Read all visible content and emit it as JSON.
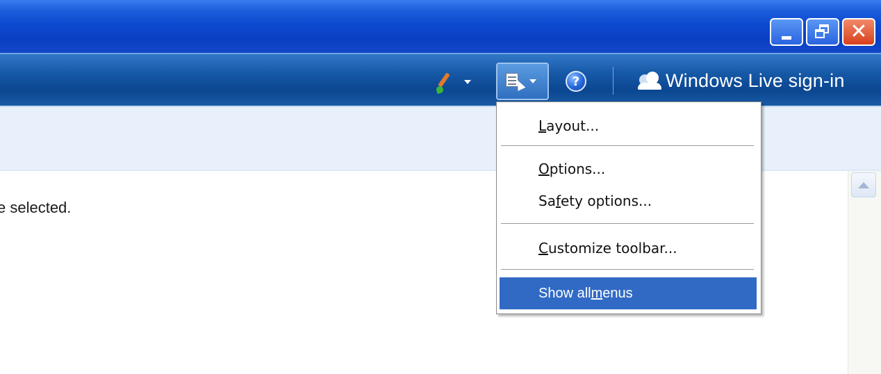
{
  "window": {
    "controls": {
      "minimize_icon": "minimize-icon",
      "restore_icon": "restore-icon",
      "close_icon": "close-icon",
      "close_glyph": "✕"
    }
  },
  "toolbar": {
    "brush_icon": "paintbrush-icon",
    "tools_icon": "tools-page-icon",
    "help_glyph": "?",
    "signin_label": "Windows Live sign-in"
  },
  "content": {
    "status_text": "e selected."
  },
  "menu": {
    "items": [
      {
        "pre": "",
        "key": "L",
        "post": "ayout..."
      },
      {
        "pre": "",
        "key": "O",
        "post": "ptions..."
      },
      {
        "pre": "Sa",
        "key": "f",
        "post": "ety options..."
      },
      {
        "pre": "",
        "key": "C",
        "post": "ustomize toolbar..."
      },
      {
        "pre": "Show all ",
        "key": "m",
        "post": "enus"
      }
    ],
    "highlighted_index": 4
  },
  "colors": {
    "titlebar": "#0d4ad0",
    "toolbar": "#175aa8",
    "menu_highlight": "#316ac5",
    "close_button": "#d8401c"
  }
}
